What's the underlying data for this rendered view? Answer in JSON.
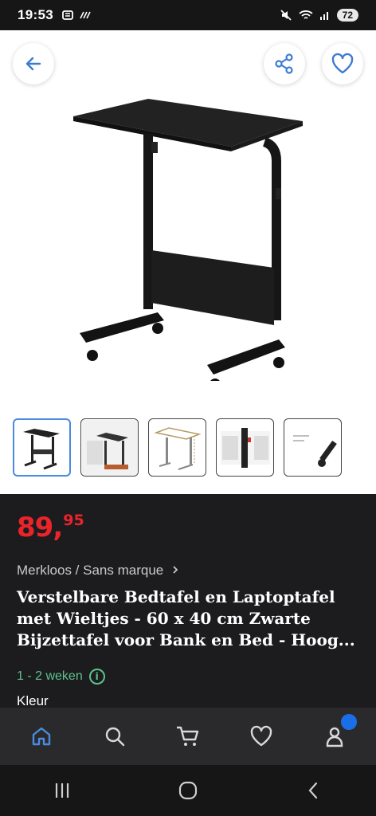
{
  "status_bar": {
    "time": "19:53",
    "battery": "72"
  },
  "price": {
    "main": "89,",
    "cents": "95"
  },
  "product": {
    "brand": "Merkloos / Sans marque",
    "title": "Verstelbare Bedtafel en Laptoptafel met Wieltjes - 60 x 40 cm Zwarte Bijzettafel voor Bank en Bed - Hoog...",
    "delivery": "1 - 2 weken",
    "color_label": "Kleur"
  },
  "colors": {
    "price": "#e9242a",
    "delivery": "#5fc28e",
    "accent": "#4a8bdf",
    "badge": "#1a6fe8"
  },
  "icons": {
    "back": "arrow-left-icon",
    "share": "share-icon",
    "favorite": "heart-icon",
    "nav": [
      "home-icon",
      "search-icon",
      "cart-icon",
      "heart-icon",
      "user-icon"
    ]
  }
}
